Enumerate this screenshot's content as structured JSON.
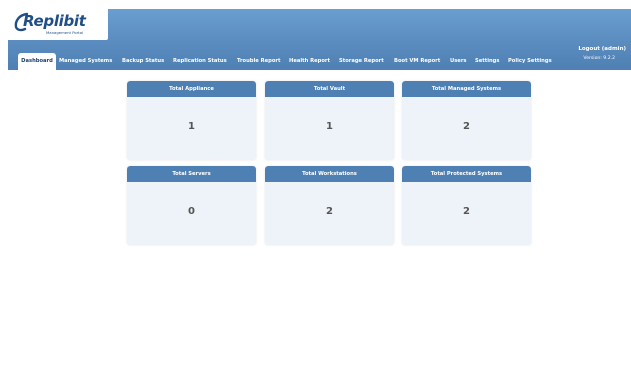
{
  "app": {
    "logo_text": "Replibit",
    "logo_subtitle": "Management Portal"
  },
  "header": {
    "logout_label": "Logout (admin)",
    "version_label": "Version: 9.2.2"
  },
  "nav": {
    "items": [
      {
        "label": "Dashboard",
        "active": true
      },
      {
        "label": "Managed Systems"
      },
      {
        "label": "Backup Status"
      },
      {
        "label": "Replication Status"
      },
      {
        "label": "Trouble Report"
      },
      {
        "label": "Health Report"
      },
      {
        "label": "Storage Report"
      },
      {
        "label": "Boot VM Report"
      },
      {
        "label": "Users"
      },
      {
        "label": "Settings"
      },
      {
        "label": "Policy Settings"
      }
    ]
  },
  "dashboard": {
    "cards": [
      {
        "title": "Total Appliance",
        "value": "1"
      },
      {
        "title": "Total Vault",
        "value": "1"
      },
      {
        "title": "Total Managed Systems",
        "value": "2"
      },
      {
        "title": "Total Servers",
        "value": "0"
      },
      {
        "title": "Total Workstations",
        "value": "2"
      },
      {
        "title": "Total Protected Systems",
        "value": "2"
      }
    ]
  },
  "colors": {
    "header_blue": "#5a8cc0",
    "card_header": "#4f80b4",
    "card_body": "#eef3f9",
    "logo_blue": "#1f4f86"
  }
}
